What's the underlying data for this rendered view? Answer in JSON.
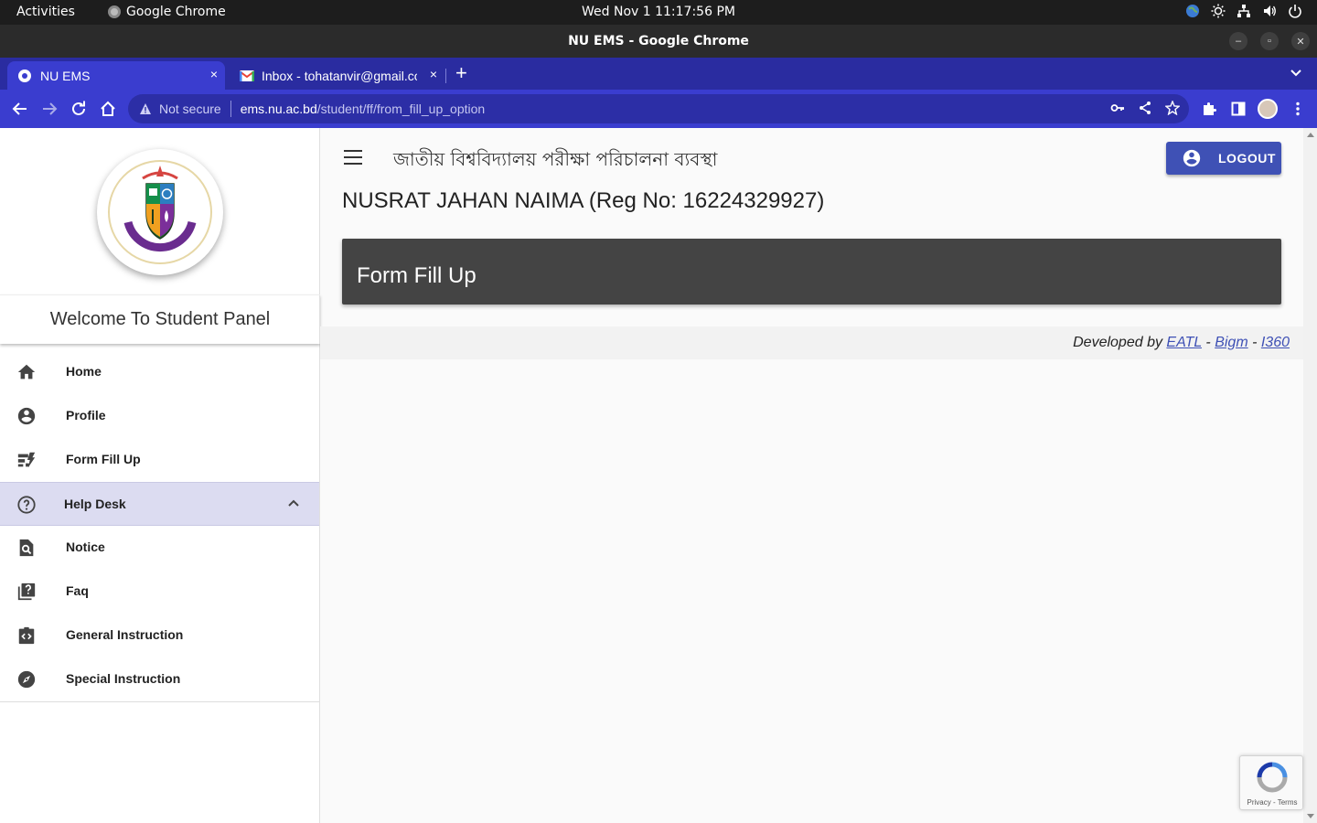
{
  "system_bar": {
    "activities": "Activities",
    "app_name": "Google Chrome",
    "clock": "Wed Nov 1  11:17:56 PM"
  },
  "window": {
    "title": "NU EMS - Google Chrome"
  },
  "tabs": [
    {
      "label": "NU EMS",
      "close": "×"
    },
    {
      "label": "Inbox - tohatanvir@gmail.com",
      "close": "×"
    }
  ],
  "new_tab": "+",
  "address_bar": {
    "security_label": "Not secure",
    "host": "ems.nu.ac.bd",
    "path": "/student/ff/from_fill_up_option"
  },
  "sidebar": {
    "welcome": "Welcome To Student Panel",
    "items": [
      {
        "label": "Home",
        "icon": "home-icon"
      },
      {
        "label": "Profile",
        "icon": "account-circle-icon"
      },
      {
        "label": "Form Fill Up",
        "icon": "form-icon"
      },
      {
        "label": "Help Desk",
        "icon": "help-circle-icon"
      },
      {
        "label": "Notice",
        "icon": "find-in-page-icon"
      },
      {
        "label": "Faq",
        "icon": "question-library-icon"
      },
      {
        "label": "General Instruction",
        "icon": "code-clipboard-icon"
      },
      {
        "label": "Special Instruction",
        "icon": "compass-icon"
      }
    ]
  },
  "header": {
    "site_title": "জাতীয় বিশ্ববিদ্যালয় পরীক্ষা পরিচালনা ব্যবস্থা",
    "logout_label": "LOGOUT"
  },
  "main": {
    "student_name": "NUSRAT JAHAN NAIMA (Reg No: 16224329927)",
    "card_title": "Form Fill Up"
  },
  "footer": {
    "prefix": "Developed by ",
    "links": [
      "EATL",
      "Bigm",
      "I360"
    ],
    "separator": " - "
  },
  "recaptcha": {
    "links": "Privacy - Terms"
  },
  "colors": {
    "accent": "#3f51b5",
    "browser_frame": "#3a3dcf",
    "card_bg": "#444444",
    "helpdesk_highlight": "#dcdcf1"
  }
}
